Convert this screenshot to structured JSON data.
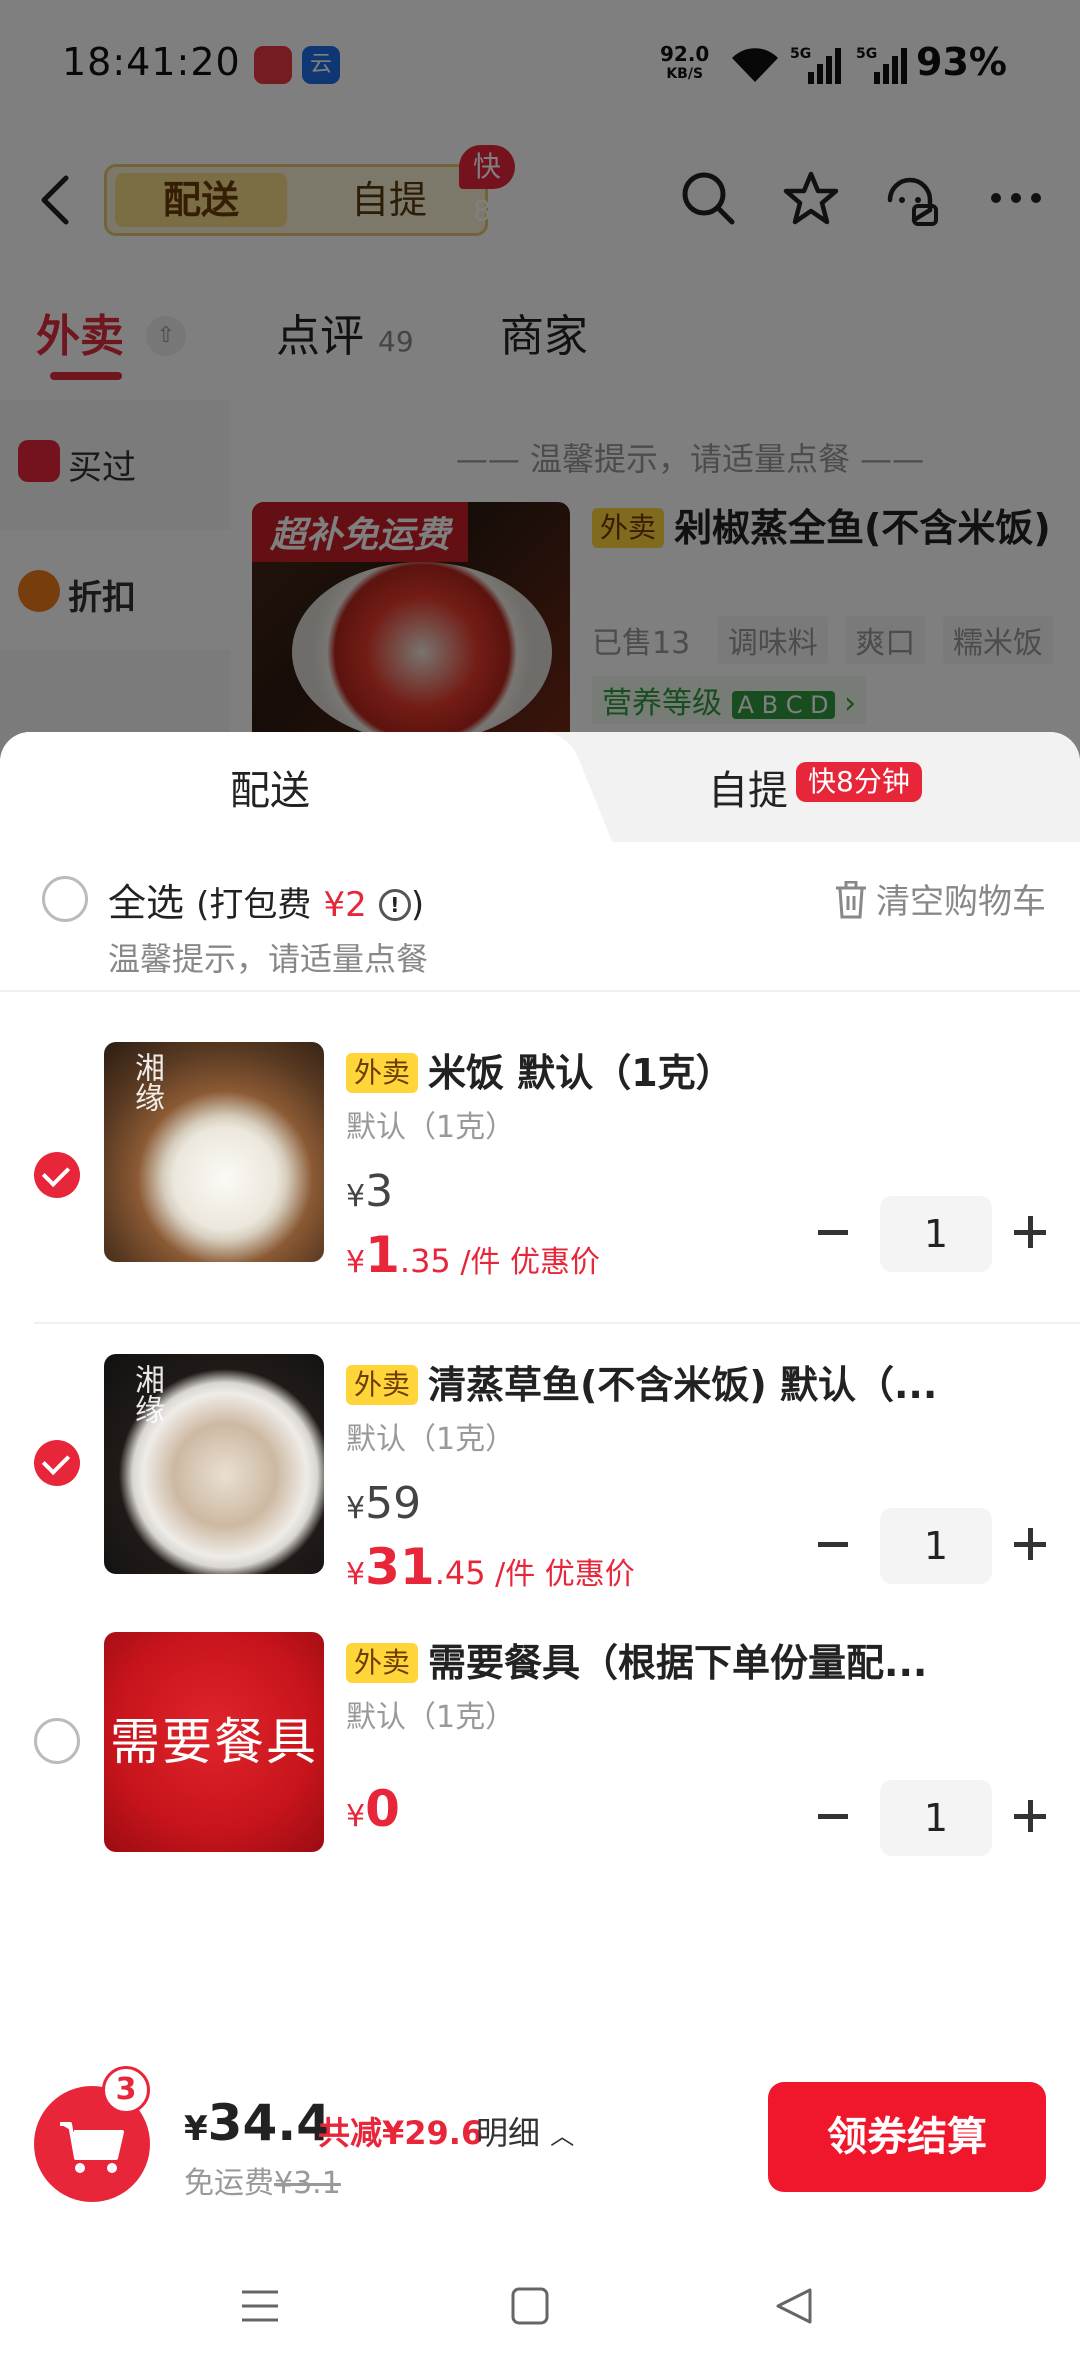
{
  "status_bar": {
    "time": "18:41:20",
    "net_speed_value": "92.0",
    "net_speed_unit": "KB/S",
    "signal_1": "5G",
    "signal_2": "5G",
    "battery": "93%"
  },
  "header": {
    "mode_delivery": "配送",
    "mode_pickup": "自提",
    "pickup_badge": "快8分钟"
  },
  "store_tabs": {
    "takeout": "外卖",
    "reviews": "点评",
    "reviews_count": "49",
    "merchant": "商家"
  },
  "left_nav": {
    "bought": "买过",
    "discount": "折扣"
  },
  "menu": {
    "hint": "—— 温馨提示，请适量点餐 ——",
    "ribbon": "超补免运费",
    "product_tag": "外卖",
    "product_title": "剁椒蒸全鱼(不含米饭)",
    "sold": "已售13",
    "tags": [
      "调味料",
      "爽口",
      "糯米饭"
    ],
    "nutrition": "营养等级",
    "nutrition_grades": "A B C D"
  },
  "cart": {
    "tab_delivery": "配送",
    "tab_pickup": "自提",
    "tab_pickup_badge": "快8分钟",
    "select_all": "全选",
    "pack_fee_prefix": "(打包费",
    "pack_fee": "¥2",
    "pack_fee_suffix": ")",
    "hint": "温馨提示，请适量点餐",
    "clear": "清空购物车",
    "items": [
      {
        "checked": true,
        "tag": "外卖",
        "title": "米饭 默认（1克）",
        "spec": "默认（1克）",
        "yen": "¥",
        "orig_price": "3",
        "deal_int": "1",
        "deal_dec": ".35",
        "deal_suffix": "/件 优惠价",
        "qty": "1",
        "image_text": "湘缘"
      },
      {
        "checked": true,
        "tag": "外卖",
        "title": "清蒸草鱼(不含米饭) 默认（...",
        "spec": "默认（1克）",
        "yen": "¥",
        "orig_price": "59",
        "deal_int": "31",
        "deal_dec": ".45",
        "deal_suffix": "/件 优惠价",
        "qty": "1",
        "image_text": "湘缘"
      },
      {
        "checked": false,
        "tag": "外卖",
        "title": "需要餐具（根据下单份量配...",
        "spec": "默认（1克）",
        "yen": "¥",
        "price": "0",
        "qty": "1",
        "image_text": "需要餐具"
      }
    ]
  },
  "checkout_bar": {
    "cart_count": "3",
    "yen": "¥",
    "total": "34.4",
    "saving": "共减¥29.6",
    "detail": "明细",
    "free_ship": "免运费",
    "orig_ship": "¥3.1",
    "checkout_label": "领券结算"
  },
  "colors": {
    "accent": "#e8263a",
    "brand_yellow": "#ffd53a",
    "checkout": "#f0172c"
  }
}
